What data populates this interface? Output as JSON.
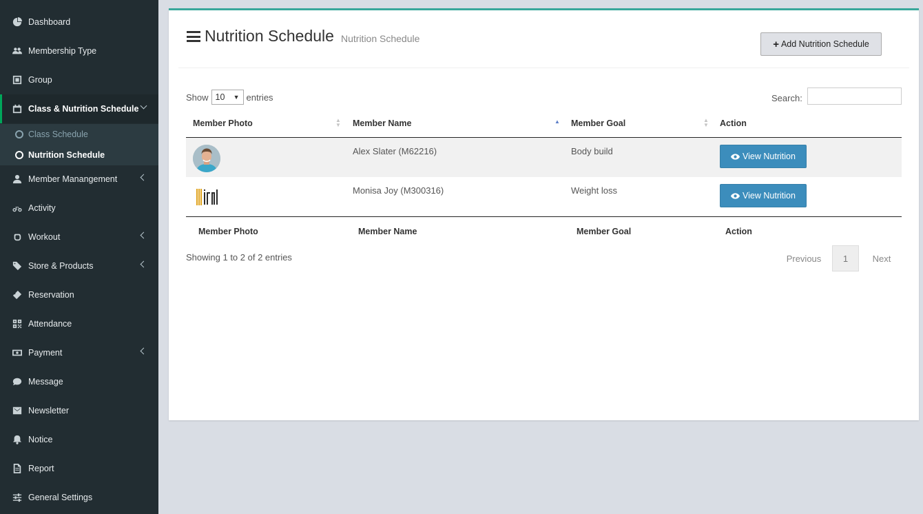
{
  "sidebar": {
    "items": [
      {
        "label": "Dashboard",
        "icon": "dashboard-icon"
      },
      {
        "label": "Membership Type",
        "icon": "users-icon"
      },
      {
        "label": "Group",
        "icon": "group-icon"
      },
      {
        "label": "Class & Nutrition Schedule",
        "icon": "calendar-icon"
      },
      {
        "label": "Member Manangement",
        "icon": "user-icon"
      },
      {
        "label": "Activity",
        "icon": "bicycle-icon"
      },
      {
        "label": "Workout",
        "icon": "hand-icon"
      },
      {
        "label": "Store & Products",
        "icon": "tags-icon"
      },
      {
        "label": "Reservation",
        "icon": "ticket-icon"
      },
      {
        "label": "Attendance",
        "icon": "qrcode-icon"
      },
      {
        "label": "Payment",
        "icon": "money-icon"
      },
      {
        "label": "Message",
        "icon": "comment-icon"
      },
      {
        "label": "Newsletter",
        "icon": "envelope-icon"
      },
      {
        "label": "Notice",
        "icon": "bell-icon"
      },
      {
        "label": "Report",
        "icon": "file-icon"
      },
      {
        "label": "General Settings",
        "icon": "sliders-icon"
      }
    ],
    "submenu": [
      {
        "label": "Class Schedule"
      },
      {
        "label": "Nutrition Schedule"
      }
    ]
  },
  "header": {
    "title": "Nutrition Schedule",
    "subtitle": "Nutrition Schedule",
    "add_button": "Add Nutrition Schedule"
  },
  "controls": {
    "show_label": "Show",
    "entries_value": "10",
    "entries_label": "entries",
    "search_label": "Search:"
  },
  "table": {
    "columns": [
      "Member Photo",
      "Member Name",
      "Member Goal",
      "Action"
    ],
    "rows": [
      {
        "name": "Alex Slater (M62216)",
        "goal": "Body build",
        "action": "View Nutrition"
      },
      {
        "name": "Monisa Joy (M300316)",
        "goal": "Weight loss",
        "action": "View Nutrition"
      }
    ],
    "footer": [
      "Member Photo",
      "Member Name",
      "Member Goal",
      "Action"
    ]
  },
  "pagination": {
    "info": "Showing 1 to 2 of 2 entries",
    "previous": "Previous",
    "page": "1",
    "next": "Next"
  },
  "colors": {
    "sidebar_bg": "#222d32",
    "active_accent": "#00a65a",
    "box_accent": "#3aa79a",
    "button_primary": "#3c8dbc"
  }
}
